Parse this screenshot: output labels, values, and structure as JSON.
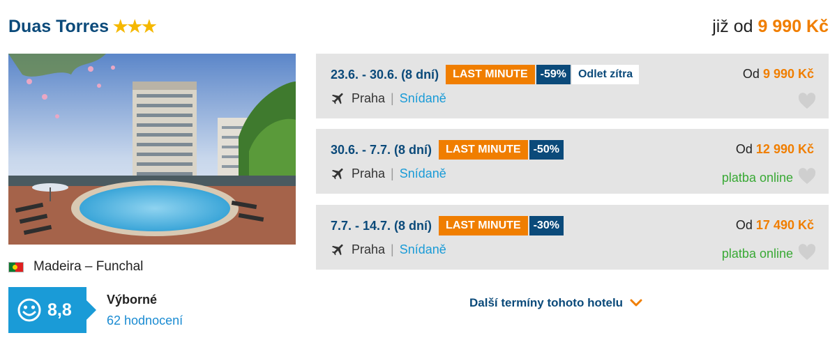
{
  "hotel": {
    "name": "Duas Torres",
    "stars": "★★★",
    "from_prefix": "již od",
    "from_price": "9 990 Kč",
    "location": "Madeira – Funchal"
  },
  "rating": {
    "score": "8,8",
    "word": "Výborné",
    "count": "62 hodnocení"
  },
  "offers": [
    {
      "dates": "23.6. - 30.6. (8 dní)",
      "badge": "LAST MINUTE",
      "discount": "-59%",
      "extra_badge": "Odlet zítra",
      "departure": "Praha",
      "separator": "|",
      "board": "Snídaně",
      "price_prefix": "Od",
      "price": "9 990 Kč",
      "payment": ""
    },
    {
      "dates": "30.6. - 7.7. (8 dní)",
      "badge": "LAST MINUTE",
      "discount": "-50%",
      "departure": "Praha",
      "separator": "|",
      "board": "Snídaně",
      "price_prefix": "Od",
      "price": "12 990 Kč",
      "payment": "platba online"
    },
    {
      "dates": "7.7. - 14.7. (8 dní)",
      "badge": "LAST MINUTE",
      "discount": "-30%",
      "departure": "Praha",
      "separator": "|",
      "board": "Snídaně",
      "price_prefix": "Od",
      "price": "17 490 Kč",
      "payment": "platba online"
    }
  ],
  "more_link": "Další termíny tohoto hotelu",
  "icons": {
    "flag": "portugal-flag-icon",
    "rating": "smiley-icon",
    "departure": "plane-icon",
    "favorite": "heart-icon",
    "expand": "chevron-down-icon"
  },
  "colors": {
    "brand_blue": "#0b4a7a",
    "accent_orange": "#f07e00",
    "rating_blue": "#1a9bd7",
    "online_green": "#39a935",
    "offer_bg": "#e4e4e4"
  }
}
